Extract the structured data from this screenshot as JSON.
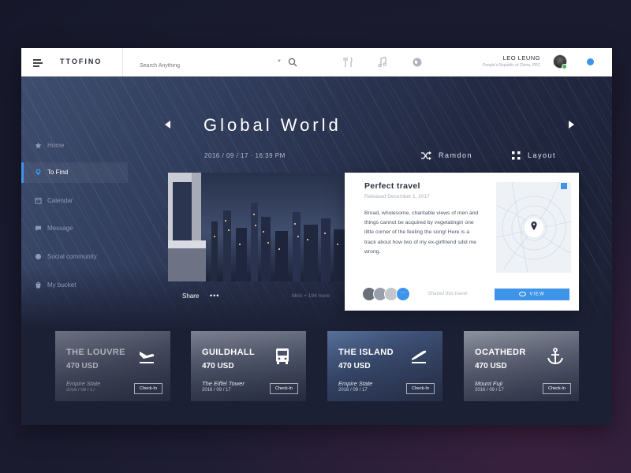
{
  "app": {
    "logo": "TTOFINO"
  },
  "search": {
    "placeholder": "Search Anything"
  },
  "top_icons": [
    "cutlery-icon",
    "music-icon",
    "globe-icon"
  ],
  "user": {
    "name": "LEO LEUNG",
    "location": "People's Republic of China, PRC"
  },
  "sidebar": {
    "items": [
      {
        "label": "Home",
        "icon": "star-icon",
        "active": false
      },
      {
        "label": "To Find",
        "icon": "location-pin-icon",
        "active": true
      },
      {
        "label": "Calendar",
        "icon": "calendar-icon",
        "active": false
      },
      {
        "label": "Message",
        "icon": "chat-icon",
        "active": false
      },
      {
        "label": "Social community",
        "icon": "globe-icon",
        "active": false
      },
      {
        "label": "My bucket",
        "icon": "bucket-icon",
        "active": false
      }
    ]
  },
  "hero": {
    "title": "Global World",
    "date": "2016 / 09 / 17 · 16:39 PM",
    "ramdon_label": "Ramdon",
    "layout_label": "Layout"
  },
  "feature": {
    "share_label": "Share",
    "dots": "•••",
    "more_text": "Mick + 194 more"
  },
  "card": {
    "title": "Perfect travel",
    "released": "Released December 1, 2017",
    "description": "Broad, wholesome, charitable views of men and things cannot be acquired by vegetatingin one little corner of the feeling the song!  Here is a track about how two of my ex-girlfriend sdid me wrong.",
    "avatar_more": "···",
    "shares_text": "Shared this travel",
    "view_label": "VIEW"
  },
  "destinations": [
    {
      "name": "THE LOUVRE",
      "price": "470 USD",
      "place": "Empire State",
      "date": "2016 / 09 / 17",
      "checkin": "Check-In",
      "icon": "plane-landing-icon",
      "faded": true
    },
    {
      "name": "GUILDHALL",
      "price": "470 USD",
      "place": "The Eiffel Tower",
      "date": "2016 / 09 / 17",
      "checkin": "Check-In",
      "icon": "bus-icon",
      "faded": false
    },
    {
      "name": "THE ISLAND",
      "price": "470 USD",
      "place": "Empire State",
      "date": "2016 / 09 / 17",
      "checkin": "Check-In",
      "icon": "plane-takeoff-icon",
      "faded": false
    },
    {
      "name": "OCATHEDR",
      "price": "470 USD",
      "place": "Mount Fuji",
      "date": "2016 / 09 / 17",
      "checkin": "Check-In",
      "icon": "anchor-icon",
      "faded": false
    }
  ],
  "colors": {
    "accent": "#3e94e8",
    "background": "#1b2035",
    "card": "#ffffff"
  }
}
